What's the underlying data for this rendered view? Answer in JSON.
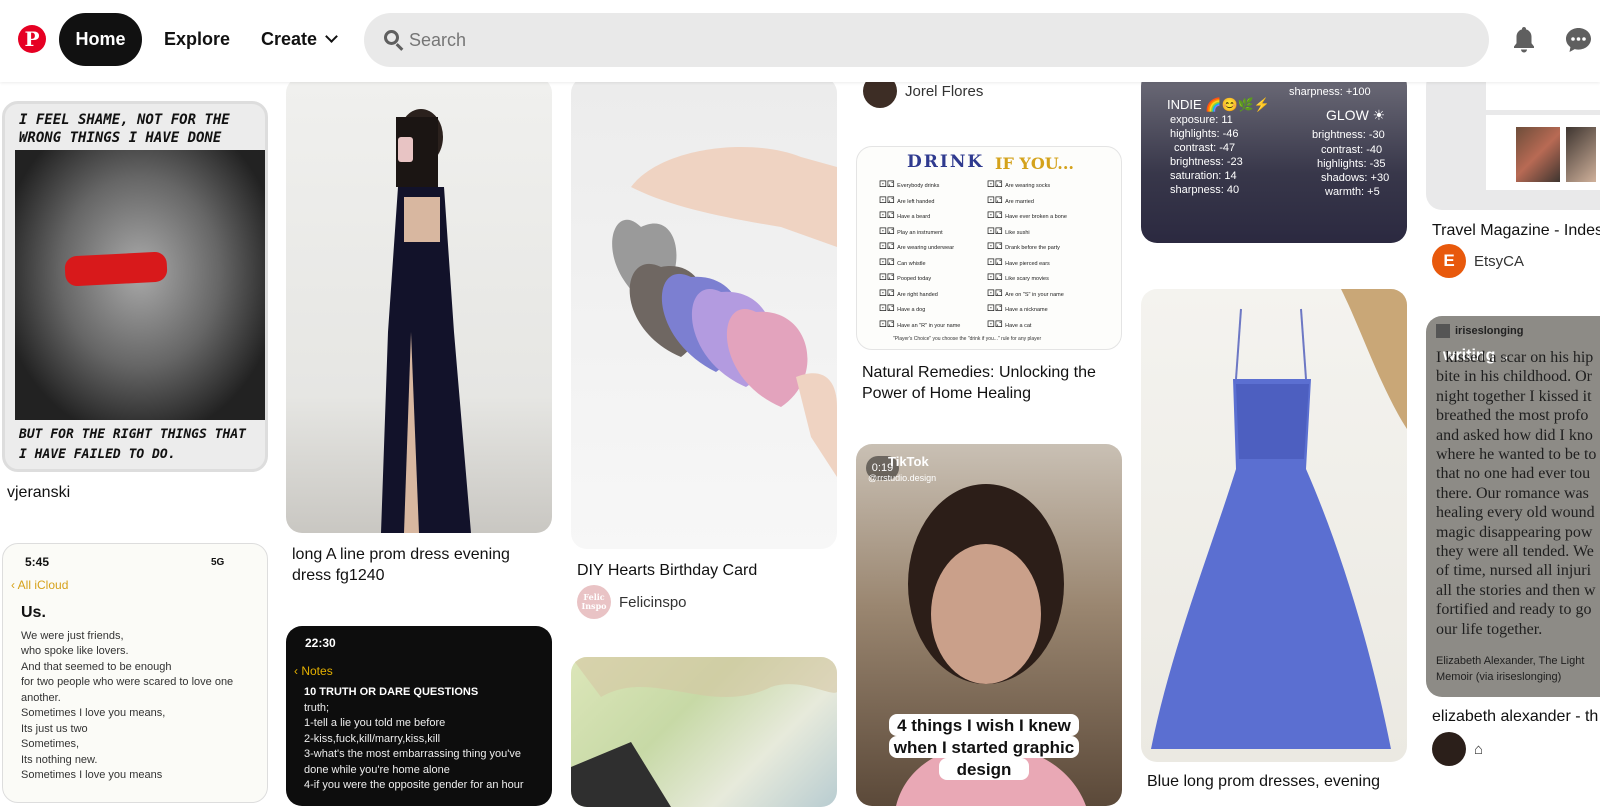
{
  "header": {
    "logo": "P",
    "nav": {
      "home": "Home",
      "explore": "Explore",
      "create": "Create"
    },
    "search_placeholder": "Search"
  },
  "pins": {
    "shame": {
      "top_text_1": "I FEEL SHAME, NOT FOR THE",
      "top_text_2": "WRONG THINGS I HAVE DONE",
      "bottom_text_1": "BUT FOR THE RIGHT THINGS THAT",
      "bottom_text_2": "I HAVE FAILED TO DO.",
      "title": "vjeranski"
    },
    "us_note": {
      "time": "5:45",
      "signal": "5G",
      "back": "All iCloud",
      "heading": "Us.",
      "lines": [
        "We were just friends,",
        "who spoke like lovers.",
        "And that seemed to be enough",
        "for two people who were scared to love one",
        "another.",
        "Sometimes I love you means,",
        "Its just us two",
        "Sometimes,",
        "Its nothing new.",
        "Sometimes I love you means"
      ]
    },
    "prom_dress": {
      "title_1": "long A line prom dress evening",
      "title_2": "dress fg1240"
    },
    "truth_dare": {
      "time": "22:30",
      "back": "Notes",
      "lines": [
        "10 TRUTH OR DARE QUESTIONS",
        "truth;",
        "1-tell a lie you told me before",
        "2-kiss,fuck,kill/marry,kiss,kill",
        "3-what's the most embarrassing thing you've",
        "done while you're home alone",
        "4-if you were the opposite gender for an hour"
      ]
    },
    "hearts": {
      "title": "DIY Hearts Birthday Card",
      "user": "Felicinspo",
      "avatar_text": "Felic Inspo"
    },
    "jorel": {
      "user": "Jorel Flores"
    },
    "drink": {
      "heading_1": "DRINK",
      "heading_2": "IF YOU...",
      "left": [
        "Everybody drinks",
        "Are left handed",
        "Have a beard",
        "Play an instrument",
        "Are wearing underwear",
        "Can whistle",
        "Pooped today",
        "Are right handed",
        "Have a dog",
        "Have an \"R\" in your name"
      ],
      "right": [
        "Are wearing socks",
        "Are married",
        "Have ever broken a bone",
        "Like sushi",
        "Drank before the party",
        "Have pierced ears",
        "Like scary movies",
        "Are on \"S\" in your name",
        "Have a nickname",
        "Have a cat"
      ],
      "footer": "\"Player's Choice\" you choose the \"drink if you...\" rule for any player",
      "title_1": "Natural Remedies: Unlocking the",
      "title_2": "Power of Home Healing"
    },
    "tiktok": {
      "duration": "0:19",
      "brand": "TikTok",
      "handle": "@rrstudio.design",
      "caption_1": "4 things I wish I knew",
      "caption_2": "when I started graphic",
      "caption_3": "design"
    },
    "glow": {
      "indie_heading": "INDIE",
      "indie": [
        "exposure: 11",
        "highlights: -46",
        "contrast: -47",
        "brightness: -23",
        "saturation: 14",
        "sharpness: 40"
      ],
      "sharpness_top": "sharpness: +100",
      "glow_heading": "GLOW",
      "glow": [
        "brightness: -30",
        "contrast: -40",
        "highlights: -35",
        "shadows: +30",
        "warmth: +5"
      ]
    },
    "blue_dress": {
      "title": "Blue long prom dresses, evening"
    },
    "travel": {
      "title": "Travel Magazine - Indes",
      "user": "EtsyCA",
      "avatar_letter": "E"
    },
    "writing": {
      "account": "iriseslonging",
      "tag": "writing",
      "lines": [
        "I kissed a scar on his hip",
        "bite in his childhood. Or",
        "night together I kissed it",
        "breathed the most profo",
        "and asked how did I kno",
        "where he wanted to be to",
        "that no one had ever tou",
        "there. Our romance was",
        "healing every old wound",
        "magic disappearing pow",
        "they were all tended. We",
        "of time, nursed all injuri",
        "all the stories and then w",
        "fortified and ready to go",
        "our life together."
      ],
      "credit_1": "Elizabeth Alexander, The Light",
      "credit_2": "Memoir (via iriseslonging)",
      "title": "elizabeth alexander - th"
    }
  },
  "colors": {
    "brand": "#e60023",
    "home_bg": "#111111",
    "search_bg": "#e9e9e9",
    "etsy": "#e8590c"
  }
}
